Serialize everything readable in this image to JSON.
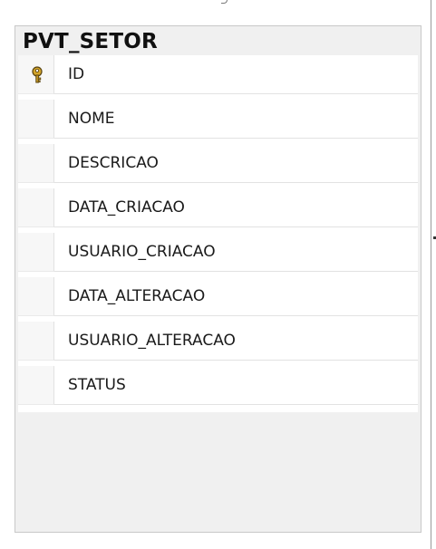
{
  "table": {
    "title": "PVT_SETOR",
    "columns": [
      {
        "name": "ID",
        "icon": "primary-key-icon"
      },
      {
        "name": "NOME",
        "icon": ""
      },
      {
        "name": "DESCRICAO",
        "icon": ""
      },
      {
        "name": "DATA_CRIACAO",
        "icon": ""
      },
      {
        "name": "USUARIO_CRIACAO",
        "icon": ""
      },
      {
        "name": "DATA_ALTERACAO",
        "icon": ""
      },
      {
        "name": "USUARIO_ALTERACAO",
        "icon": ""
      },
      {
        "name": "STATUS",
        "icon": ""
      }
    ]
  },
  "colors": {
    "table_background": "#f0f0f0",
    "grid_background": "#ffffff",
    "key_icon_fill": "#d4a52a",
    "text": "#1a1a1a"
  }
}
